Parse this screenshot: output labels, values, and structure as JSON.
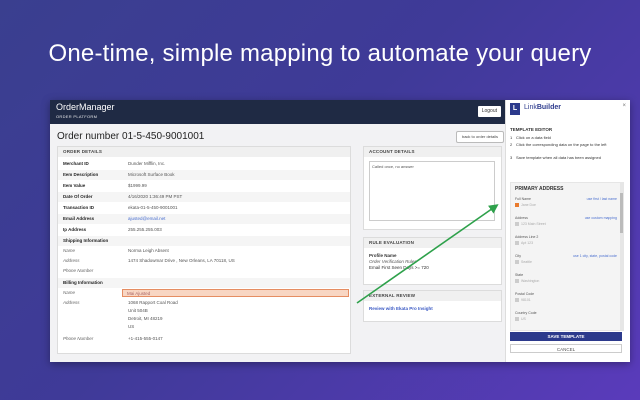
{
  "headline": "One-time, simple mapping to automate your query",
  "colors": {
    "accent": "#2c3a8c",
    "highlight": "#f8d6c3",
    "arrow": "#2ea14b",
    "topbar": "#1f2a44"
  },
  "app": {
    "brand": "OrderManager",
    "brand_sub": "ORDER PLATFORM",
    "logout": "Logout",
    "order_title": "Order number 01-5-450-9001001",
    "back_button": "back to order details"
  },
  "order_details": {
    "header": "ORDER DETAILS",
    "rows": [
      {
        "label": "Merchant ID",
        "value": "Dunder Mifflin, Inc."
      },
      {
        "label": "Item Description",
        "value": "Microsoft Surface Book"
      },
      {
        "label": "Item Value",
        "value": "$1999.99"
      },
      {
        "label": "Date Of Order",
        "value": "4/16/2020 1:36:49 PM PST"
      },
      {
        "label": "Transaction ID",
        "value": "ekata-01-5-450-9001001"
      },
      {
        "label": "Email Address",
        "value": "ajusted@email.net"
      },
      {
        "label": "Ip Address",
        "value": "255.255.255.003"
      }
    ],
    "shipping": {
      "header": "Shipping Information",
      "name_label": "Name",
      "name_value": "Norma Leigh Absent",
      "address_label": "Address",
      "address_value": "1474 Shadowmar Drive , New Orleans, LA 70118, US",
      "phone_label": "Phone Number",
      "phone_value": ""
    },
    "billing": {
      "header": "Billing Information",
      "name_label": "Name",
      "name_value": "Mai Ajusted",
      "address_label": "Address",
      "address_lines": [
        "1068 Rapport Coal Road",
        "Unit 504B",
        "Detroit, MI 48219",
        "US"
      ],
      "phone_label": "Phone Number",
      "phone_value": "+1-415-555-0147"
    }
  },
  "account_details": {
    "header": "ACCOUNT DETAILS",
    "note": "Called once, no answer"
  },
  "rule_evaluation": {
    "header": "RULE EVALUATION",
    "profile": "Profile Name",
    "line1": "Order Verification Rules",
    "line2": "Email First Seen Days >= 720"
  },
  "external_review": {
    "header": "EXTERNAL REVIEW",
    "link": "Review with Ekata Pro Insight"
  },
  "linkbuilder": {
    "logo": "L",
    "name_light": "Link",
    "name_bold": "Builder",
    "close": "×",
    "template_editor": "TEMPLATE EDITOR",
    "steps": [
      {
        "n": "1",
        "text": "Click on a data field"
      },
      {
        "n": "2",
        "text": "Click the corresponding data on the page to the left"
      },
      {
        "n": "3",
        "text": "Save template when all data has been assigned"
      }
    ],
    "primary_address": "PRIMARY ADDRESS",
    "fields": [
      {
        "label": "Full Name",
        "link": "use first / last name",
        "value": "Jane Doe",
        "on": true
      },
      {
        "label": "Address",
        "link": "use custom mapping",
        "value": "123 Main Street",
        "on": false
      },
      {
        "label": "Address Line 2",
        "link": "",
        "value": "Apt 123",
        "on": false
      },
      {
        "label": "City",
        "link": "use 1 city, state, postal code",
        "value": "Seattle",
        "on": false
      },
      {
        "label": "State",
        "link": "",
        "value": "Washington",
        "on": false
      },
      {
        "label": "Postal Code",
        "link": "",
        "value": "98101",
        "on": false
      },
      {
        "label": "Country Code",
        "link": "",
        "value": "US",
        "on": false
      }
    ],
    "save": "SAVE TEMPLATE",
    "cancel": "CANCEL"
  }
}
